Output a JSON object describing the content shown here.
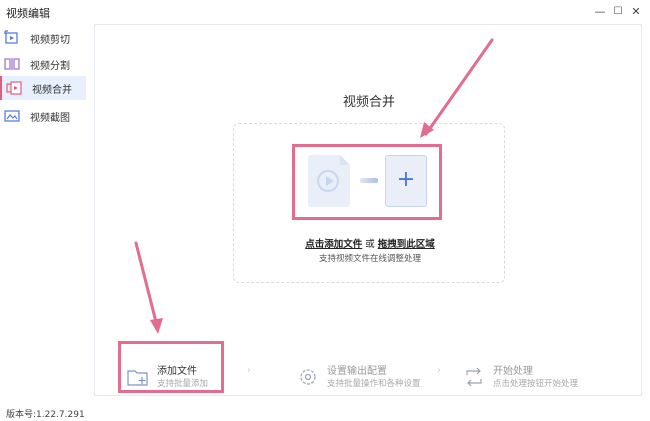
{
  "window": {
    "title": "视频编辑",
    "minimize": "—",
    "maximize": "☐",
    "close": "✕"
  },
  "sidebar": {
    "items": [
      {
        "label": "视频剪切",
        "icon": "crop-video-icon"
      },
      {
        "label": "视频分割",
        "icon": "split-video-icon"
      },
      {
        "label": "视频合并",
        "icon": "merge-video-icon"
      },
      {
        "label": "视频截图",
        "icon": "screenshot-icon"
      }
    ],
    "active_index": 2
  },
  "main": {
    "heading": "视频合并",
    "dropzone": {
      "action_text": "点击添加文件",
      "or_text": " 或 ",
      "drag_text": "拖拽到此区域",
      "subtext": "支持视频文件在线调整处理",
      "plus": "+"
    },
    "steps": [
      {
        "title": "添加文件",
        "subtitle": "支持批量添加",
        "icon": "add-folder-icon"
      },
      {
        "title": "设置输出配置",
        "subtitle": "支持批量操作和各种设置",
        "icon": "settings-gear-icon"
      },
      {
        "title": "开始处理",
        "subtitle": "点击处理按钮开始处理",
        "icon": "process-arrows-icon"
      }
    ],
    "separator": "›"
  },
  "footer": {
    "version": "版本号:1.22.7.291"
  },
  "colors": {
    "accent_pink": "#e26d8f",
    "accent_blue": "#4a74d6",
    "sidebar_active": "#e8f0fe"
  }
}
